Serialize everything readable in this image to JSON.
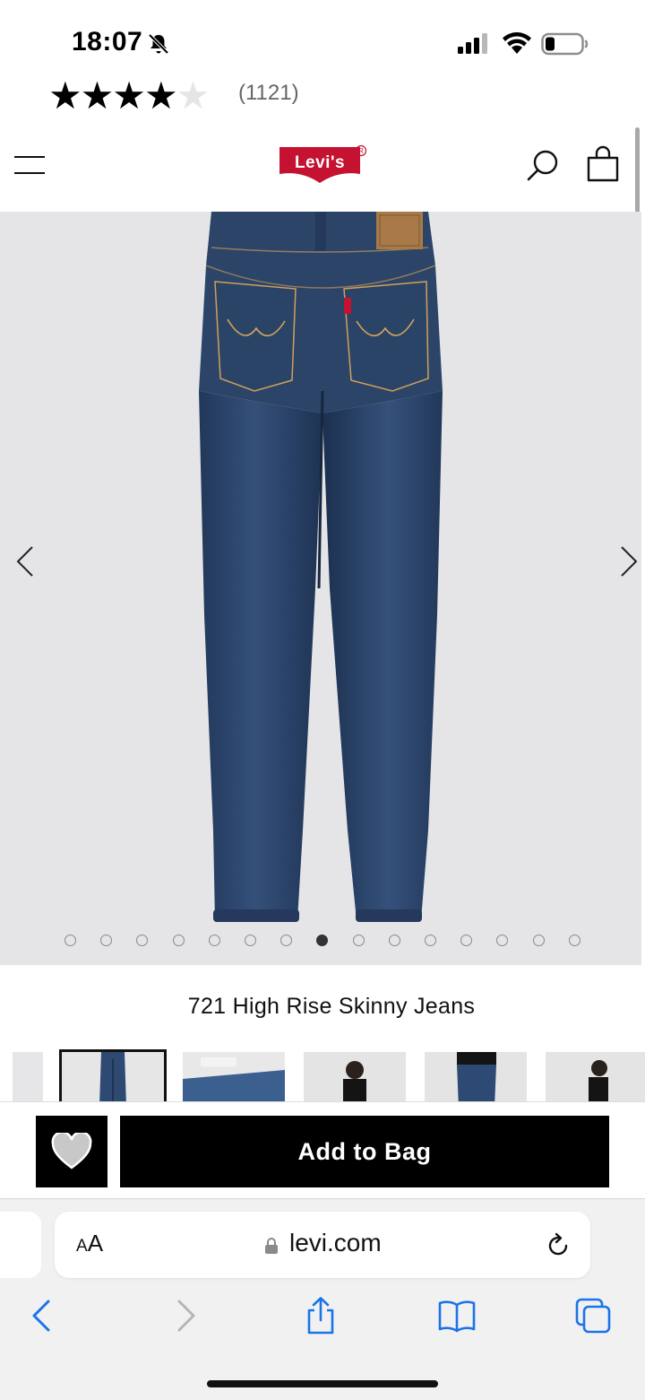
{
  "status_bar": {
    "time": "18:07",
    "icons": [
      "bell-slash-icon",
      "cellular-signal-icon",
      "wifi-icon",
      "battery-icon"
    ]
  },
  "rating": {
    "filled_stars": 4,
    "total_stars": 5,
    "review_count": "(1121)"
  },
  "header": {
    "logo_text": "Levi's",
    "icons": [
      "hamburger-menu-icon",
      "search-icon",
      "shopping-bag-icon"
    ]
  },
  "gallery": {
    "image_count": 15,
    "active_index": 7,
    "icons": [
      "chevron-left-icon",
      "chevron-right-icon"
    ]
  },
  "product": {
    "title": "721 High Rise Skinny Jeans"
  },
  "actions": {
    "add_to_bag": "Add to Bag",
    "favorite_icon": "heart-icon"
  },
  "browser": {
    "text_size_label": "AA",
    "domain": "levi.com",
    "toolbar_icons": [
      "back-icon",
      "forward-icon",
      "share-icon",
      "bookmarks-icon",
      "tabs-icon"
    ]
  },
  "colors": {
    "brand_red": "#c41230",
    "primary_black": "#000000",
    "safari_blue": "#1a74e8",
    "gallery_bg": "#e5e5e7"
  }
}
